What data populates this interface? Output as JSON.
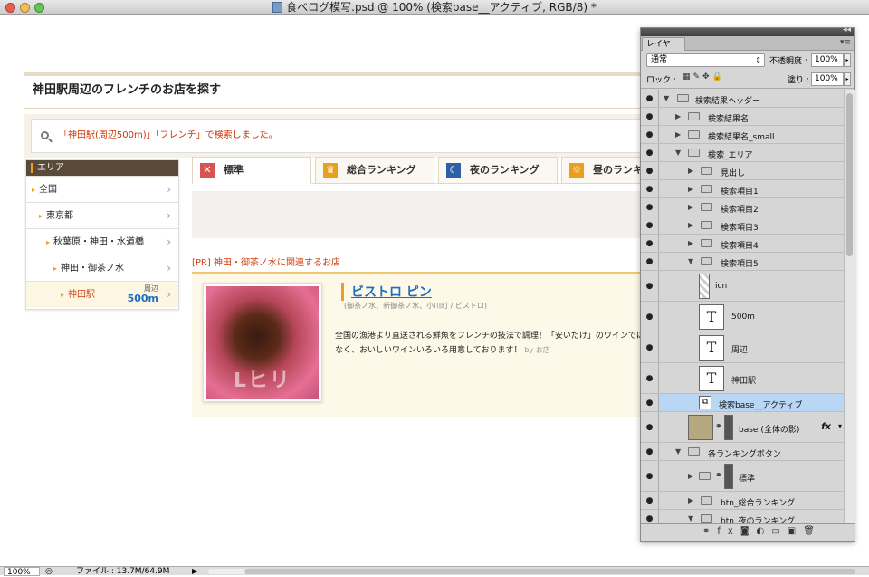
{
  "window": {
    "title": "食べログ模写.psd @ 100% (検索base__アクティブ, RGB/8) *"
  },
  "colors": {
    "close": "#ee5c52",
    "minimize": "#f4bf4f",
    "zoom": "#61c554",
    "accent": "#e8a020",
    "link": "#1a6fc0",
    "red_text": "#d04010"
  },
  "page": {
    "heading": "神田駅周辺のフレンチのお店を探す",
    "search_message": "「神田駅(周辺500m)」「フレンチ」で検索しました。",
    "area": {
      "title": "エリア",
      "items": [
        {
          "label": "全国"
        },
        {
          "label": "東京都"
        },
        {
          "label": "秋葉原・神田・水道橋"
        },
        {
          "label": "神田・御茶ノ水"
        },
        {
          "label": "神田駅",
          "near_label": "周辺",
          "near_value": "500m"
        }
      ]
    },
    "tabs": [
      {
        "label": "標準",
        "icon": "x-icon"
      },
      {
        "label": "総合ランキング",
        "icon": "crown-icon"
      },
      {
        "label": "夜のランキング",
        "icon": "moon-icon"
      },
      {
        "label": "昼のランキ",
        "icon": "sun-icon"
      }
    ],
    "pr_label": "[PR] 神田・御茶ノ水に関連するお店",
    "restaurant": {
      "name": "ビストロ ピン",
      "meta": "(御茶ノ水、新御茶ノ水、小川町 / ビストロ)",
      "description": "全国の漁港より直送される鮮魚をフレンチの技法で調理！「安いだけ」のワインではなく、おいしいワインいろいろ用意しております！",
      "by": "by お店"
    }
  },
  "status": {
    "zoom": "100%",
    "file_info": "ファイル : 13.7M/64.9M"
  },
  "layers_panel": {
    "tab": "レイヤー",
    "blend_mode": "通常",
    "opacity_label": "不透明度 :",
    "opacity": "100%",
    "lock_label": "ロック :",
    "fill_label": "塗り :",
    "fill": "100%",
    "layers": [
      {
        "name": "検索結果ヘッダー"
      },
      {
        "name": "検索結果名"
      },
      {
        "name": "検索結果名_small"
      },
      {
        "name": "検索_エリア"
      },
      {
        "name": "見出し"
      },
      {
        "name": "検索項目1"
      },
      {
        "name": "検索項目2"
      },
      {
        "name": "検索項目3"
      },
      {
        "name": "検索項目4"
      },
      {
        "name": "検索項目5"
      },
      {
        "name": "icn"
      },
      {
        "name": "500m"
      },
      {
        "name": "周辺"
      },
      {
        "name": "神田駅"
      },
      {
        "name": "検索base__アクティブ"
      },
      {
        "name": "base (全体の影)"
      },
      {
        "name": "各ランキングボタン"
      },
      {
        "name": "標準"
      },
      {
        "name": "btn_総合ランキング"
      },
      {
        "name": "btn_夜のランキング"
      }
    ]
  }
}
